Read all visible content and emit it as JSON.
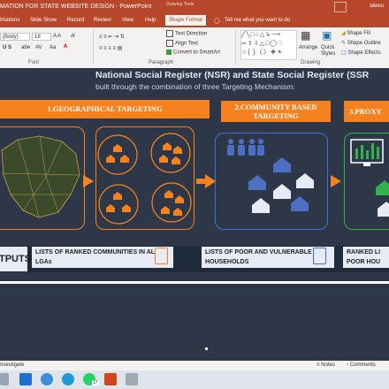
{
  "window": {
    "title": "MATION FOR STATE WEBSITE DESIGN  -  PowerPoint",
    "contextual_group": "Drawing Tools",
    "user": "idewu"
  },
  "tabs": [
    "imations",
    "Slide Show",
    "Record",
    "Review",
    "View",
    "Help",
    "Shape Format"
  ],
  "tell_me": "Tell me what you want to do",
  "ribbon": {
    "font_name": "(Body)",
    "font_size": "18",
    "text_direction": "Text Direction",
    "align_text": "Align Text",
    "convert_smartart": "Convert to SmartArt",
    "arrange": "Arrange",
    "quick_styles": "Quick Styles",
    "shape_fill": "Shape Fill",
    "shape_outline": "Shape Outline",
    "shape_effects": "Shape Effects",
    "group_font": "Font",
    "group_paragraph": "Paragraph",
    "group_drawing": "Drawing"
  },
  "slide": {
    "title": "National Social Register (NSR) and State Social Register (SSR",
    "subtitle": "built through the combination of three Targeting Mechanism:",
    "mechanisms": [
      {
        "label": "1.GEOGRAPHICAL TARGETING"
      },
      {
        "label": "2.COMMUNITY BASED TARGETING"
      },
      {
        "label": "3.PROXY"
      }
    ],
    "outputs_label": "TPUTS",
    "outputs": [
      "LISTS OF RANKED COMMUNITIES IN ALL LGAs",
      "LISTS OF POOR AND VULNERABLE HOUSEHOLDS",
      "RANKED LI POOR HOU"
    ],
    "colors": {
      "orange": "#f6821f",
      "blue": "#3b6fd6",
      "green": "#2fb34a",
      "accent": "#b7472a"
    }
  },
  "status": {
    "left": "nvestigate",
    "notes": "Notes",
    "comments": "Comments"
  },
  "taskbar": {
    "badge": "17"
  }
}
